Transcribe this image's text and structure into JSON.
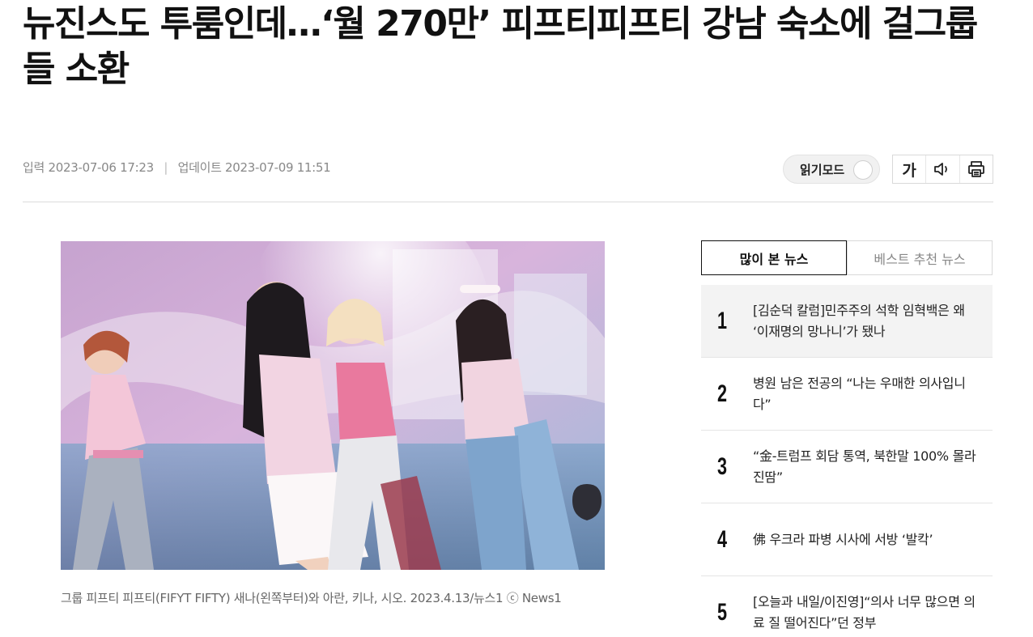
{
  "article": {
    "headline": "뉴진스도 투룸인데…‘월 270만’ 피프티피프티 강남 숙소에 걸그룹들 소환",
    "meta": {
      "published_label": "입력",
      "published": "2023-07-06 17:23",
      "separator": "|",
      "updated_label": "업데이트",
      "updated": "2023-07-09 11:51"
    },
    "tools": {
      "reader_mode_label": "읽기모드",
      "font_size_label": "가",
      "speaker_icon": "speaker-icon",
      "print_icon": "print-icon"
    },
    "photo": {
      "caption": "그룹 피프티 피프티(FIFYT FIFTY) 새나(왼쪽부터)와 아란, 키나, 시오. 2023.4.13/뉴스1 ⓒ News1"
    }
  },
  "sidebar": {
    "tabs": [
      {
        "label": "많이 본 뉴스",
        "active": true
      },
      {
        "label": "베스트 추천 뉴스",
        "active": false
      }
    ],
    "items": [
      {
        "rank": "1",
        "title": "[김순덕 칼럼]민주주의 석학 임혁백은 왜 ‘이재명의 망나니’가 됐나"
      },
      {
        "rank": "2",
        "title": "병원 남은 전공의 “나는 우매한 의사입니다”"
      },
      {
        "rank": "3",
        "title": "“金-트럼프 회담 통역, 북한말 100% 몰라 진땀”"
      },
      {
        "rank": "4",
        "title": "佛 우크라 파병 시사에 서방 ‘발칵’"
      },
      {
        "rank": "5",
        "title": "[오늘과 내일/이진영]“의사 너무 많으면 의료 질 떨어진다”던 정부"
      }
    ]
  },
  "colors": {
    "text": "#111111",
    "muted": "#888888",
    "border": "#d9d9d9",
    "highlight_bg": "#f3f3f3"
  }
}
